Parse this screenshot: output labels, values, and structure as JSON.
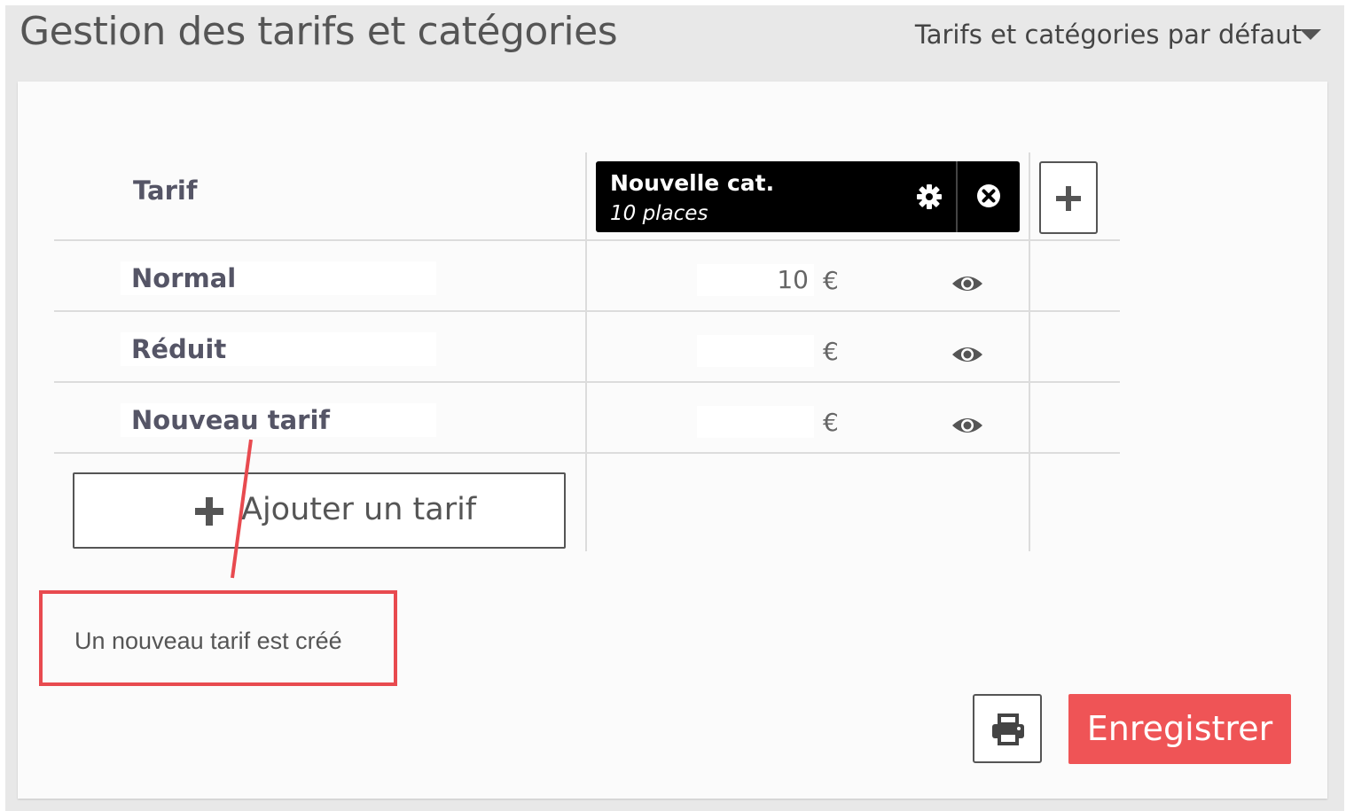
{
  "header": {
    "title": "Gestion des tarifs et catégories",
    "preset_label": "Tarifs et catégories par défaut"
  },
  "table": {
    "tarif_header": "Tarif",
    "category": {
      "name": "Nouvelle cat.",
      "places": "10 places"
    },
    "rows": [
      {
        "label": "Normal",
        "price": "10",
        "currency": "€"
      },
      {
        "label": "Réduit",
        "price": "",
        "currency": "€"
      },
      {
        "label": "Nouveau tarif",
        "price": "",
        "currency": "€"
      }
    ],
    "add_tarif_label": "Ajouter un tarif"
  },
  "annotation": {
    "text": "Un nouveau tarif est créé"
  },
  "actions": {
    "save_label": "Enregistrer"
  },
  "colors": {
    "accent": "#ef5456",
    "callout": "#e84a4f",
    "category_bg": "#000000"
  },
  "icons": [
    "chevron-down-icon",
    "gear-icon",
    "close-circle-icon",
    "plus-icon",
    "eye-icon",
    "printer-icon"
  ]
}
